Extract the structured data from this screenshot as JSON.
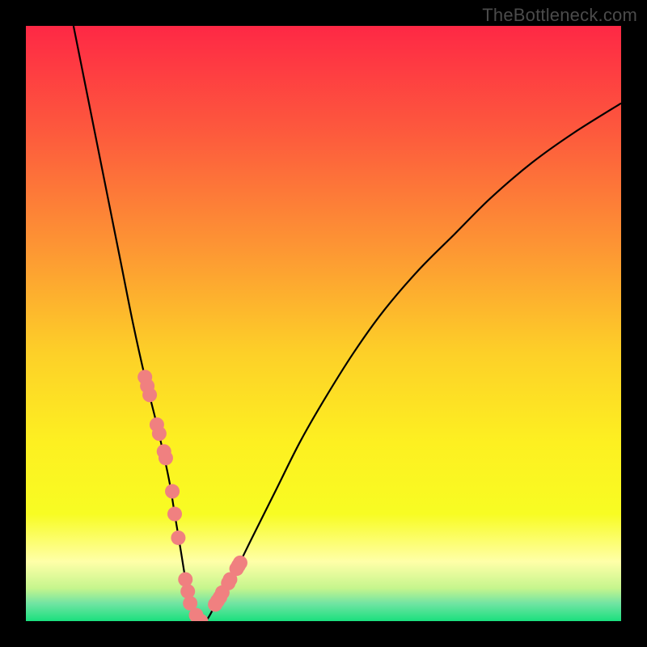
{
  "watermark": "TheBottleneck.com",
  "colors": {
    "frame": "#000000",
    "gradient_stops": [
      {
        "offset": 0.0,
        "color": "#fe2845"
      },
      {
        "offset": 0.18,
        "color": "#fd5a3d"
      },
      {
        "offset": 0.38,
        "color": "#fd9833"
      },
      {
        "offset": 0.55,
        "color": "#fdd028"
      },
      {
        "offset": 0.7,
        "color": "#fdf021"
      },
      {
        "offset": 0.82,
        "color": "#f8fc23"
      },
      {
        "offset": 0.9,
        "color": "#ffffa8"
      },
      {
        "offset": 0.945,
        "color": "#c5f58d"
      },
      {
        "offset": 0.97,
        "color": "#72e4a3"
      },
      {
        "offset": 1.0,
        "color": "#1ae07e"
      }
    ],
    "curve": "#000000",
    "marker_fill": "#f08080",
    "marker_stroke": "#d06868"
  },
  "chart_data": {
    "type": "line",
    "title": "",
    "xlabel": "",
    "ylabel": "",
    "xlim": [
      0,
      100
    ],
    "ylim": [
      0,
      100
    ],
    "grid": false,
    "legend": false,
    "series": [
      {
        "name": "bottleneck-curve",
        "x": [
          8,
          10,
          12,
          14,
          16,
          18,
          20,
          22,
          24,
          25,
          26,
          27,
          28,
          30,
          32,
          35,
          38,
          42,
          46,
          50,
          55,
          60,
          66,
          72,
          78,
          85,
          92,
          100
        ],
        "y": [
          100,
          90,
          80,
          70,
          60,
          50,
          41,
          33,
          24,
          18,
          12,
          6,
          2,
          0,
          3,
          8,
          14,
          22,
          30,
          37,
          45,
          52,
          59,
          65,
          71,
          77,
          82,
          87
        ]
      }
    ],
    "markers": {
      "name": "highlight-points",
      "x": [
        20.0,
        20.4,
        20.8,
        22.0,
        22.4,
        23.2,
        23.5,
        24.6,
        25.0,
        25.6,
        26.8,
        27.2,
        27.6,
        28.6,
        29.0,
        29.4,
        31.8,
        32.2,
        32.6,
        33.0,
        34.0,
        34.3,
        35.4,
        35.7,
        36.0
      ],
      "y": [
        41.0,
        39.5,
        38.0,
        33.0,
        31.5,
        28.5,
        27.4,
        21.8,
        18.0,
        14.0,
        7.0,
        5.0,
        3.0,
        1.0,
        0.0,
        0.0,
        2.8,
        3.4,
        4.0,
        4.8,
        6.4,
        7.0,
        8.8,
        9.3,
        9.8
      ]
    }
  }
}
